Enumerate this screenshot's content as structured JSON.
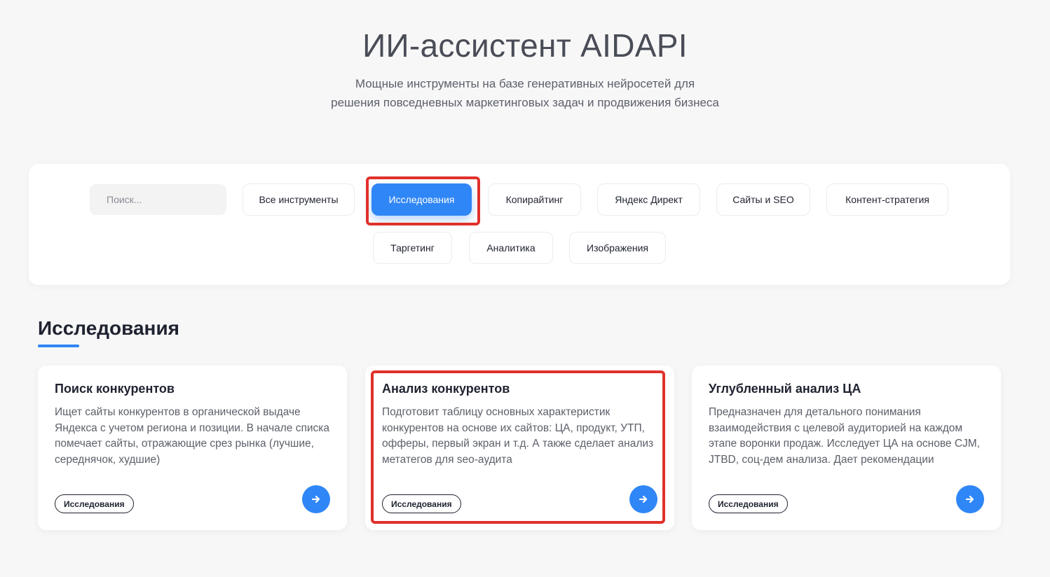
{
  "header": {
    "title": "ИИ-ассистент AIDAPI",
    "subtitle_line1": "Мощные инструменты на базе генеративных нейросетей для",
    "subtitle_line2": "решения повседневных маркетинговых задач и продвижения бизнеса"
  },
  "filters": {
    "search_placeholder": "Поиск...",
    "chips": [
      {
        "label": "Все инструменты"
      },
      {
        "label": "Исследования",
        "active": true
      },
      {
        "label": "Копирайтинг"
      },
      {
        "label": "Яндекс Директ"
      },
      {
        "label": "Сайты и SEO"
      },
      {
        "label": "Контент-стратегия"
      },
      {
        "label": "Таргетинг"
      },
      {
        "label": "Аналитика"
      },
      {
        "label": "Изображения"
      }
    ]
  },
  "section": {
    "title": "Исследования"
  },
  "cards": [
    {
      "title": "Поиск конкурентов",
      "description": "Ищет сайты конкурентов в органической выдаче Яндекса с учетом региона и позиции. В начале списка помечает сайты, отражающие срез рынка (лучшие, середнячок, худшие)",
      "tag": "Исследования"
    },
    {
      "title": "Анализ конкурентов",
      "description": "Подготовит таблицу основных характеристик конкурентов на основе их сайтов: ЦА, продукт, УТП, офферы, первый экран и т.д. А также сделает анализ метатегов для seo-аудита",
      "tag": "Исследования"
    },
    {
      "title": "Углубленный анализ ЦА",
      "description": "Предназначен для детального понимания взаимодействия с целевой аудиторией на каждом этапе воронки продаж. Исследует ЦА на основе CJM, JTBD, соц-дем анализа. Дает рекомендации",
      "tag": "Исследования"
    }
  ],
  "colors": {
    "accent": "#2f86f6",
    "highlight": "#e0312b",
    "background": "#f7f7f8"
  }
}
